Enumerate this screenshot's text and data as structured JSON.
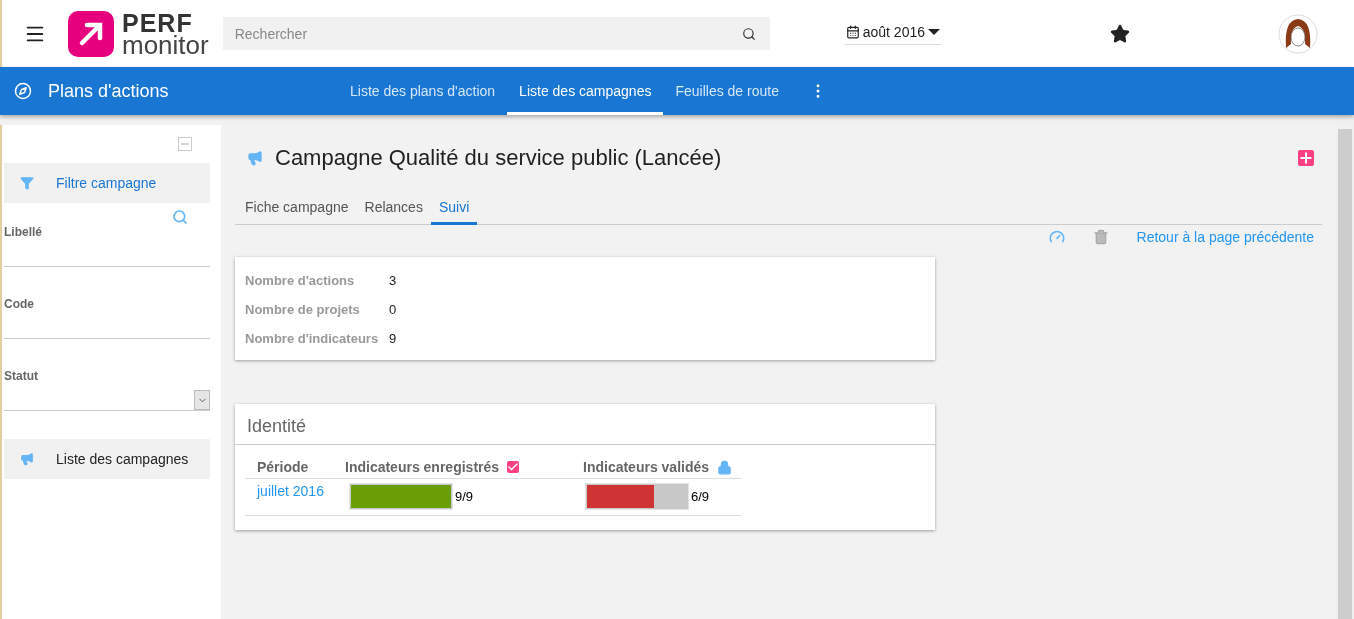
{
  "header": {
    "logo_top": "PERF",
    "logo_bottom": "monitor",
    "search": {
      "placeholder": "Rechercher"
    },
    "period": "août 2016"
  },
  "navbar": {
    "title": "Plans d'actions",
    "tabs": [
      {
        "label": "Liste des plans d'action",
        "selected": false
      },
      {
        "label": "Liste des campagnes",
        "selected": true
      },
      {
        "label": "Feuilles de route",
        "selected": false
      }
    ]
  },
  "sidebar": {
    "filter_title": "Filtre campagne",
    "fields": [
      {
        "label": "Libellé",
        "kind": "text"
      },
      {
        "label": "Code",
        "kind": "text"
      },
      {
        "label": "Statut",
        "kind": "select"
      }
    ],
    "link": "Liste des campagnes"
  },
  "page": {
    "title": "Campagne Qualité du service public (Lancée)",
    "tabs": [
      {
        "label": "Fiche campagne",
        "selected": false
      },
      {
        "label": "Relances",
        "selected": false
      },
      {
        "label": "Suivi",
        "selected": true
      }
    ],
    "back_link": "Retour à la page précédente"
  },
  "stats": [
    {
      "label": "Nombre d'actions",
      "value": "3"
    },
    {
      "label": "Nombre de projets",
      "value": "0"
    },
    {
      "label": "Nombre d'indicateurs",
      "value": "9"
    }
  ],
  "identity": {
    "title": "Identité",
    "columns": [
      "Période",
      "Indicateurs enregistrés",
      "Indicateurs validés"
    ],
    "rows": [
      {
        "period": "juillet 2016",
        "bars": [
          {
            "level": 1,
            "color": "#6a9e06",
            "reading": "9/9"
          },
          {
            "level": 0.667,
            "color": "#d03333",
            "reading": "6/9"
          }
        ]
      }
    ]
  }
}
